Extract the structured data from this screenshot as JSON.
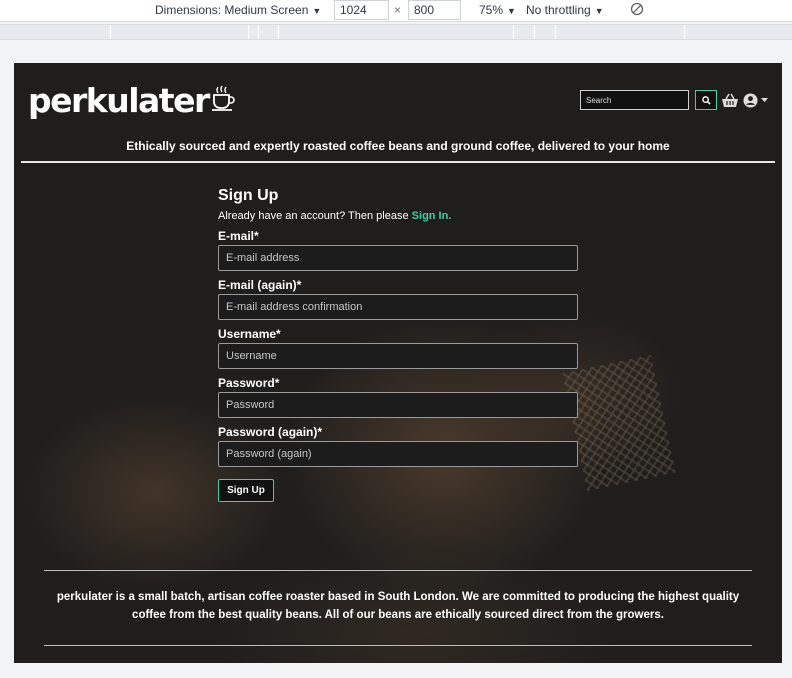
{
  "devtools": {
    "device": "Dimensions: Medium Screen",
    "width": "1024",
    "times": "×",
    "height": "800",
    "zoom": "75%",
    "throttle": "No throttling"
  },
  "site": {
    "logo": "perkulater",
    "search_placeholder": "Search",
    "tagline": "Ethically sourced and expertly roasted coffee beans and ground coffee, delivered to your home"
  },
  "signup": {
    "title": "Sign Up",
    "already_text": "Already have an account? Then please",
    "sign_in_link": "Sign In.",
    "email_label": "E-mail*",
    "email_placeholder": "E-mail address",
    "email2_label": "E-mail (again)*",
    "email2_placeholder": "E-mail address confirmation",
    "username_label": "Username*",
    "username_placeholder": "Username",
    "password_label": "Password*",
    "password_placeholder": "Password",
    "password2_label": "Password (again)*",
    "password2_placeholder": "Password (again)",
    "submit_label": "Sign Up"
  },
  "footer": {
    "about": "perkulater is a small batch, artisan coffee roaster based in South London. We are committed to producing the highest quality coffee from the best quality beans. All of our beans are ethically sourced direct from the growers."
  },
  "colors": {
    "accent": "#3fcfa6",
    "background": "#1f1e1d"
  },
  "icons": [
    "chevron-down-icon",
    "rotate-icon",
    "cup-icon",
    "search-icon",
    "basket-icon",
    "user-icon"
  ]
}
